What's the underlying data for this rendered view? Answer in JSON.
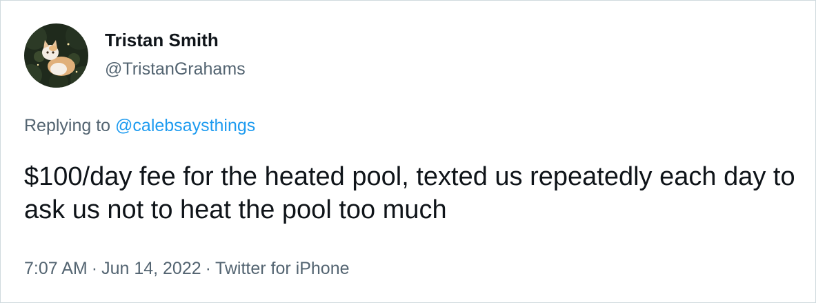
{
  "author": {
    "display_name": "Tristan Smith",
    "handle": "@TristanGrahams",
    "avatar_icon": "cat-avatar"
  },
  "reply": {
    "prefix": "Replying to",
    "mention": "@calebsaysthings"
  },
  "tweet": {
    "text": "$100/day fee for the heated pool, texted us repeatedly each day to ask us not to heat the pool too much"
  },
  "meta": {
    "time": "7:07 AM",
    "separator": "·",
    "date": "Jun 14, 2022",
    "source": "Twitter for iPhone"
  },
  "colors": {
    "text_primary": "#0f1419",
    "text_secondary": "#536471",
    "link": "#1d9bf0",
    "border": "#cfd9de"
  }
}
